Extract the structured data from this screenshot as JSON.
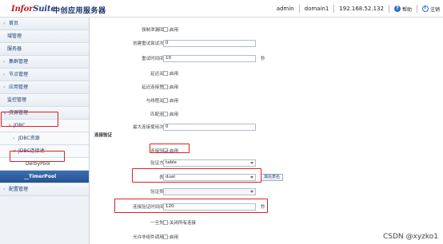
{
  "header": {
    "logo_brand": "InforSuite",
    "logo_cn": "中创应用服务器",
    "user": "admin",
    "domain": "domain1",
    "ip": "192.168.52.132",
    "help_label": "帮助",
    "logout_label": "注销"
  },
  "sidebar": {
    "items": [
      {
        "label": "首页",
        "chev": "›"
      },
      {
        "label": "域管理",
        "chev": ""
      },
      {
        "label": "服务器",
        "chev": ""
      },
      {
        "label": "集群管理",
        "chev": "›"
      },
      {
        "label": "节点管理",
        "chev": "›"
      },
      {
        "label": "应用管理",
        "chev": "›"
      },
      {
        "label": "监控管理",
        "chev": ""
      },
      {
        "label": "资源管理",
        "chev": "∨"
      },
      {
        "label": "JDBC",
        "chev": "∨"
      },
      {
        "label": "JDBC资源",
        "chev": "›"
      },
      {
        "label": "JDBC连接池",
        "chev": "∨"
      },
      {
        "label": "DerbyPool",
        "chev": ""
      },
      {
        "label": "__TimerPool",
        "chev": ""
      },
      {
        "label": "配置管理",
        "chev": "›"
      }
    ]
  },
  "form": {
    "enable_label": "启用",
    "rows": [
      {
        "label": "强制泄漏回收:",
        "type": "checkbox",
        "checked": false,
        "text": "启用"
      },
      {
        "label": "创建重试尝试次数:",
        "type": "input",
        "value": "0"
      },
      {
        "label": "重试时间间隔:",
        "type": "input",
        "value": "10",
        "unit": "秒"
      },
      {
        "label": "延迟关联:",
        "type": "checkbox",
        "checked": false,
        "text": "启用"
      },
      {
        "label": "延迟连接登记:",
        "type": "checkbox",
        "checked": false,
        "text": "启用"
      },
      {
        "label": "与线程关联:",
        "type": "checkbox",
        "checked": false,
        "text": "启用"
      },
      {
        "label": "匹配连接:",
        "type": "checkbox",
        "checked": false,
        "text": "启用"
      },
      {
        "label": "最大连接使用次数:",
        "type": "input",
        "value": "0"
      }
    ],
    "section_title": "连接验证",
    "validation": {
      "validate_label": "连接验证:",
      "validate_checked": true,
      "validate_text": "启用",
      "method_label": "验证方法:",
      "method_value": "table",
      "table_label": "表名:",
      "table_value": "dual",
      "fill_button": "填充表名",
      "classname_label": "验证类名:",
      "interval_label": "连接验证时间间隔:",
      "interval_value": "120",
      "interval_unit": "秒",
      "onfail_label": "一旦失败:",
      "onfail_text": "关闭所有连接",
      "allow_label": "允许非组件调用方:",
      "allow_text": "启用"
    }
  },
  "watermark": "CSDN @xyzko1"
}
